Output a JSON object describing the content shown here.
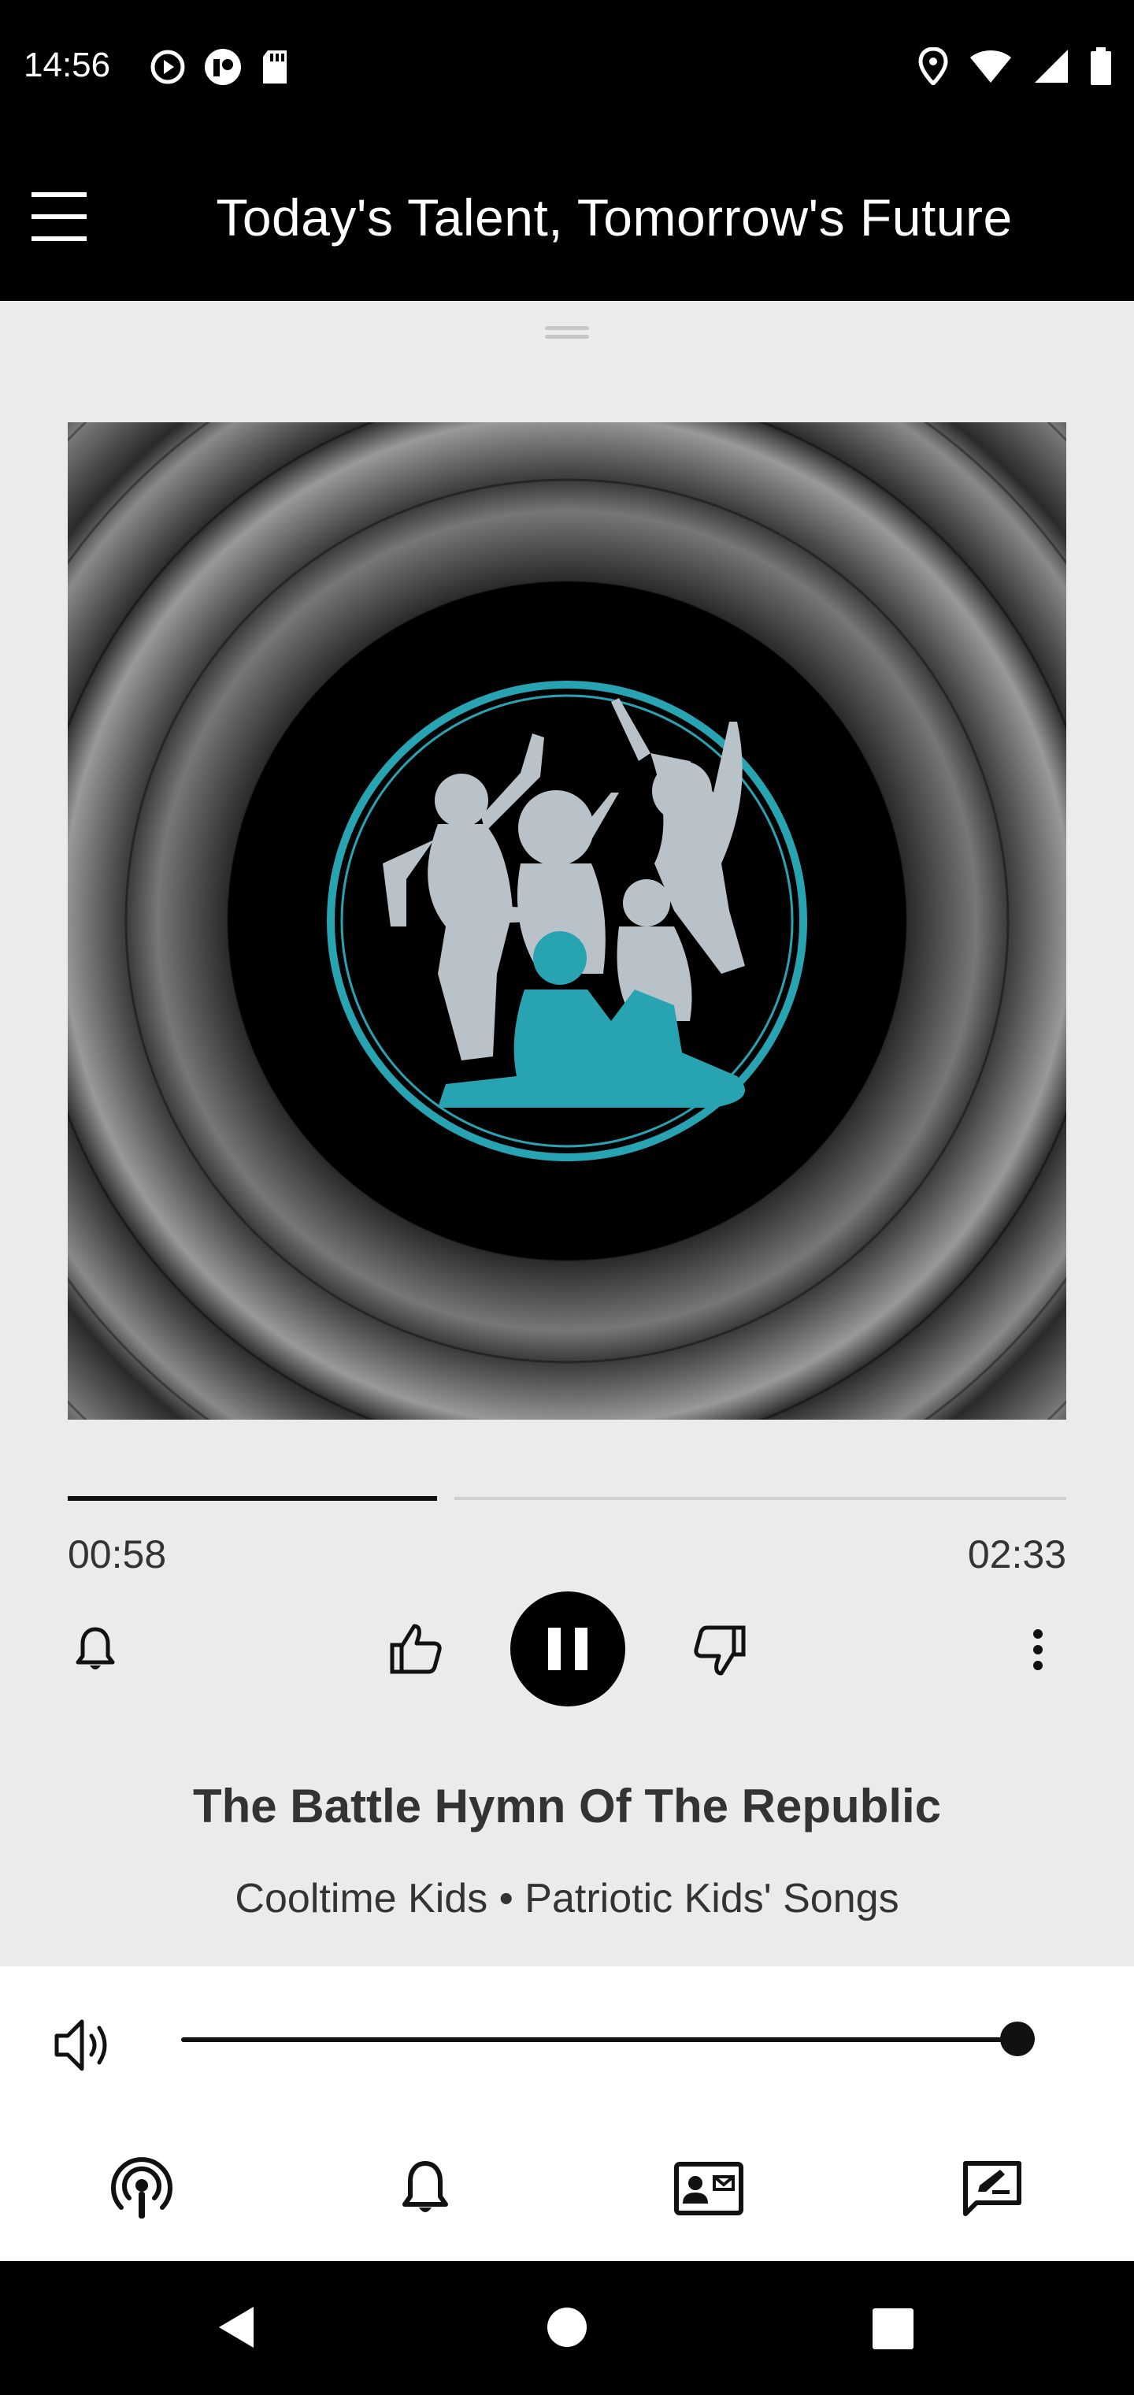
{
  "status_bar": {
    "time": "14:56",
    "left_icons": [
      "play-circle-icon",
      "notification-app-icon",
      "sd-card-icon"
    ],
    "right_icons": [
      "location-icon",
      "wifi-icon",
      "signal-icon",
      "battery-icon"
    ]
  },
  "app_bar": {
    "title": "Today's Talent, Tomorrow's Future",
    "menu_icon": "hamburger-menu-icon"
  },
  "player": {
    "progress_fraction": 0.37,
    "elapsed": "00:58",
    "duration": "02:33",
    "track_title": "The Battle Hymn Of The Republic",
    "track_subtitle": "Cooltime Kids • Patriotic Kids' Songs",
    "state": "playing",
    "controls": [
      "bell-icon",
      "thumbs-up-icon",
      "pause-icon",
      "thumbs-down-icon",
      "more-vertical-icon"
    ]
  },
  "volume": {
    "level_fraction": 1.0,
    "icon": "volume-icon"
  },
  "bottom_nav": {
    "tabs": [
      "podcast-icon",
      "bell-icon",
      "contact-card-icon",
      "feedback-icon"
    ]
  },
  "colors": {
    "background": "#ebebeb",
    "bars": "#000000",
    "accent_ring": "#27a3b2"
  }
}
